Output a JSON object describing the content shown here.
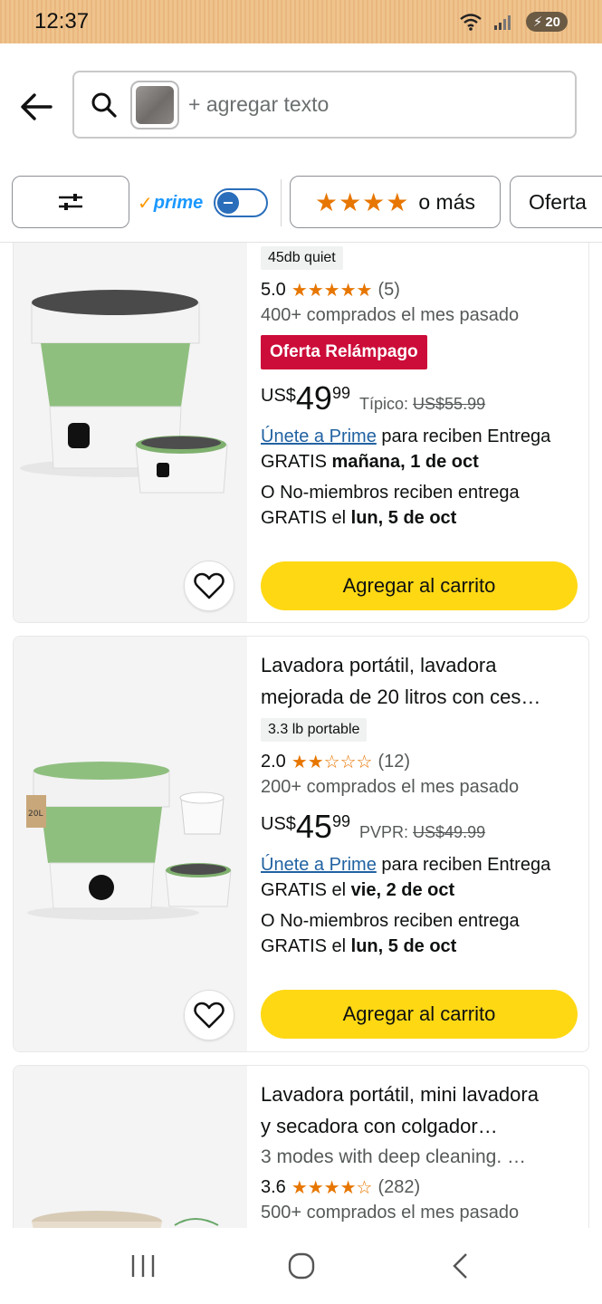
{
  "status": {
    "time": "12:37",
    "battery": "20"
  },
  "search": {
    "placeholder": "+ agregar texto"
  },
  "filters": {
    "prime_label": "prime",
    "stars_label": "o más",
    "deal_label": "Oferta"
  },
  "products": [
    {
      "tag": "45db quiet",
      "rating": "5.0",
      "stars_text": "★★★★★",
      "reviews": "(5)",
      "bought": "400+ comprados el mes pasado",
      "deal_badge": "Oferta Relámpago",
      "price_symbol": "US$",
      "price_whole": "49",
      "price_fraction": "99",
      "ref_label": "Típico:",
      "ref_price": "US$55.99",
      "prime_link": "Únete a Prime",
      "prime_text": "para reciben Entrega",
      "prime_free": "GRATIS",
      "prime_date": "mañana, 1 de oct",
      "non_member": "O No-miembros reciben entrega",
      "non_member_free": "GRATIS el",
      "non_member_date": "lun, 5 de oct",
      "add_button": "Agregar al carrito"
    },
    {
      "title_line1": "Lavadora portátil, lavadora",
      "title_line2": "mejorada de 20 litros con ces…",
      "tag": "3.3 lb portable",
      "rating": "2.0",
      "stars_text": "★★☆☆☆",
      "reviews": "(12)",
      "bought": "200+ comprados el mes pasado",
      "price_symbol": "US$",
      "price_whole": "45",
      "price_fraction": "99",
      "ref_label": "PVPR:",
      "ref_price": "US$49.99",
      "prime_link": "Únete a Prime",
      "prime_text": "para reciben Entrega",
      "prime_free": "GRATIS el",
      "prime_date": "vie, 2 de oct",
      "non_member": "O No-miembros reciben entrega",
      "non_member_free": "GRATIS el",
      "non_member_date": "lun, 5 de oct",
      "add_button": "Agregar al carrito",
      "image_label": "20L"
    },
    {
      "title_line1": "Lavadora portátil, mini lavadora",
      "title_line2": "y secadora con colgador…",
      "subtitle": "3 modes with deep cleaning. …",
      "rating": "3.6",
      "stars_text": "★★★★☆",
      "reviews": "(282)",
      "bought": "500+ comprados el mes pasado"
    }
  ],
  "colors": {
    "accent_yellow": "#ffd814",
    "deal_red": "#cc0c39",
    "star_orange": "#e77600",
    "link_blue": "#2162a1"
  }
}
